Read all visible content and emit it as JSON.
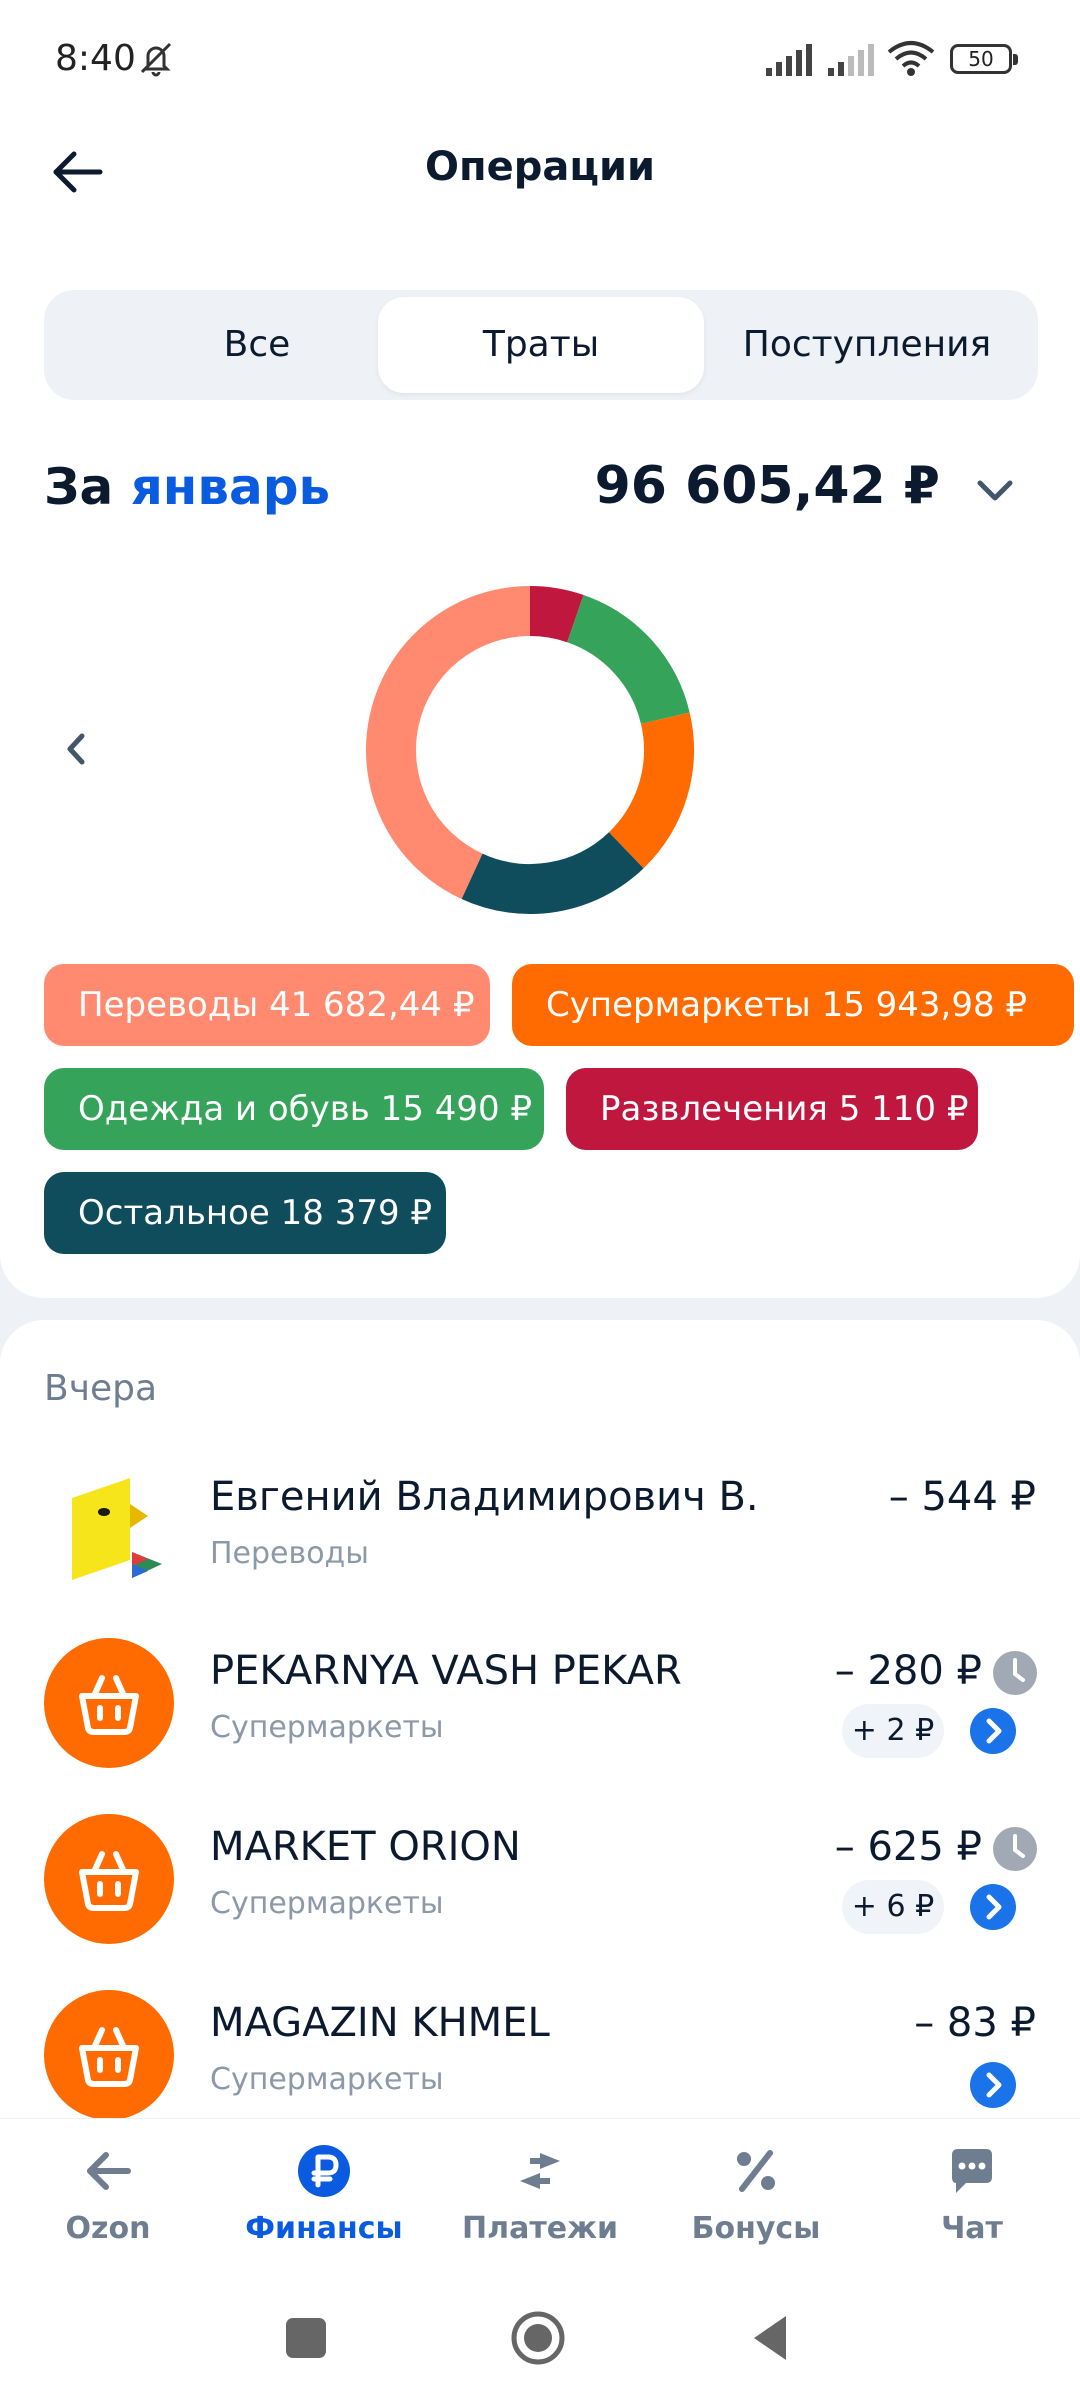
{
  "status_bar": {
    "time": "8:40",
    "battery": "50"
  },
  "header": {
    "title": "Операции"
  },
  "segments": [
    {
      "label": "Все",
      "active": false
    },
    {
      "label": "Траты",
      "active": true
    },
    {
      "label": "Поступления",
      "active": false
    }
  ],
  "period": {
    "prefix": "За",
    "month": "январь",
    "total": "96 605,42 ₽"
  },
  "chart_data": {
    "type": "pie",
    "categories": [
      "Развлечения",
      "Одежда и обувь",
      "Супермаркеты",
      "Остальное",
      "Переводы"
    ],
    "values": [
      5110,
      15490,
      15943.98,
      18379,
      41682.44
    ],
    "colors": [
      "#c0173f",
      "#35a45a",
      "#ff6b00",
      "#0f4c5c",
      "#ff8a70"
    ]
  },
  "chips": [
    {
      "label": "Переводы 41 682,44 ₽",
      "color": "#ff8a70"
    },
    {
      "label": "Супермаркеты 15 943,98 ₽",
      "color": "#ff6b00"
    },
    {
      "label": "Одежда и обувь 15 490 ₽",
      "color": "#35a45a"
    },
    {
      "label": "Развлечения 5 110 ₽",
      "color": "#c0173f"
    },
    {
      "label": "Остальное 18 379 ₽",
      "color": "#0f4c5c"
    }
  ],
  "section_label": "Вчера",
  "transactions": [
    {
      "merchant": "Евгений Владимирович В.",
      "category": "Переводы",
      "amount": "– 544 ₽",
      "icon": "bank-logo-icon"
    },
    {
      "merchant": "PEKARNYA VASH PEKAR",
      "category": "Супермаркеты",
      "amount": "– 280 ₽",
      "bonus": "+ 2 ₽",
      "icon": "basket-icon"
    },
    {
      "merchant": "MARKET ORION",
      "category": "Супермаркеты",
      "amount": "– 625 ₽",
      "bonus": "+ 6 ₽",
      "icon": "basket-icon"
    },
    {
      "merchant": "MAGAZIN KHMEL",
      "category": "Супермаркеты",
      "amount": "– 83 ₽",
      "icon": "basket-icon"
    }
  ],
  "bottom_nav": [
    {
      "label": "Ozon",
      "icon": "arrow-left-icon",
      "active": false
    },
    {
      "label": "Финансы",
      "icon": "ruble-icon",
      "active": true
    },
    {
      "label": "Платежи",
      "icon": "transfer-arrows-icon",
      "active": false
    },
    {
      "label": "Бонусы",
      "icon": "percent-icon",
      "active": false
    },
    {
      "label": "Чат",
      "icon": "chat-icon",
      "active": false
    }
  ],
  "colors": {
    "accent": "#0a5be0",
    "basket_bg": "#ff6b00"
  }
}
